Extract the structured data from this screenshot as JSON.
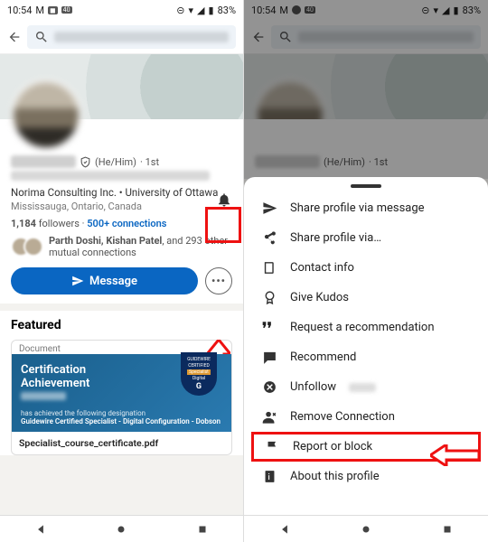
{
  "status": {
    "time": "10:54",
    "battery": "83%"
  },
  "search": {
    "placeholder": ""
  },
  "profile": {
    "pronouns": "(He/Him)",
    "degree": "· 1st",
    "workline": "Norima Consulting Inc. • University of Ottawa",
    "location": "Mississauga, Ontario, Canada",
    "followers": "1,184",
    "followers_label": "followers",
    "connections": "500+ connections",
    "mutual_names": "Parth Doshi, Kishan Patel",
    "mutual_suffix": ", and 293 other mutual connections",
    "message_label": "Message"
  },
  "featured": {
    "heading": "Featured",
    "doc_tag": "Document",
    "cert_line1": "Certification",
    "cert_line2": "Achievement",
    "cert_sub": "has achieved the following designation",
    "cert_title": "Guidewire Certified Specialist - Digital Configuration - Dobson",
    "badge_top": "GUIDEWIRE",
    "badge_mid": "CERTIFIED",
    "badge_ribbon": "Specialist",
    "badge_small": "Digital",
    "filename": "Specialist_course_certificate.pdf"
  },
  "sheet": {
    "items": [
      "Share profile via message",
      "Share profile via…",
      "Contact info",
      "Give Kudos",
      "Request a recommendation",
      "Recommend",
      "Unfollow",
      "Remove Connection",
      "Report or block",
      "About this profile"
    ]
  }
}
